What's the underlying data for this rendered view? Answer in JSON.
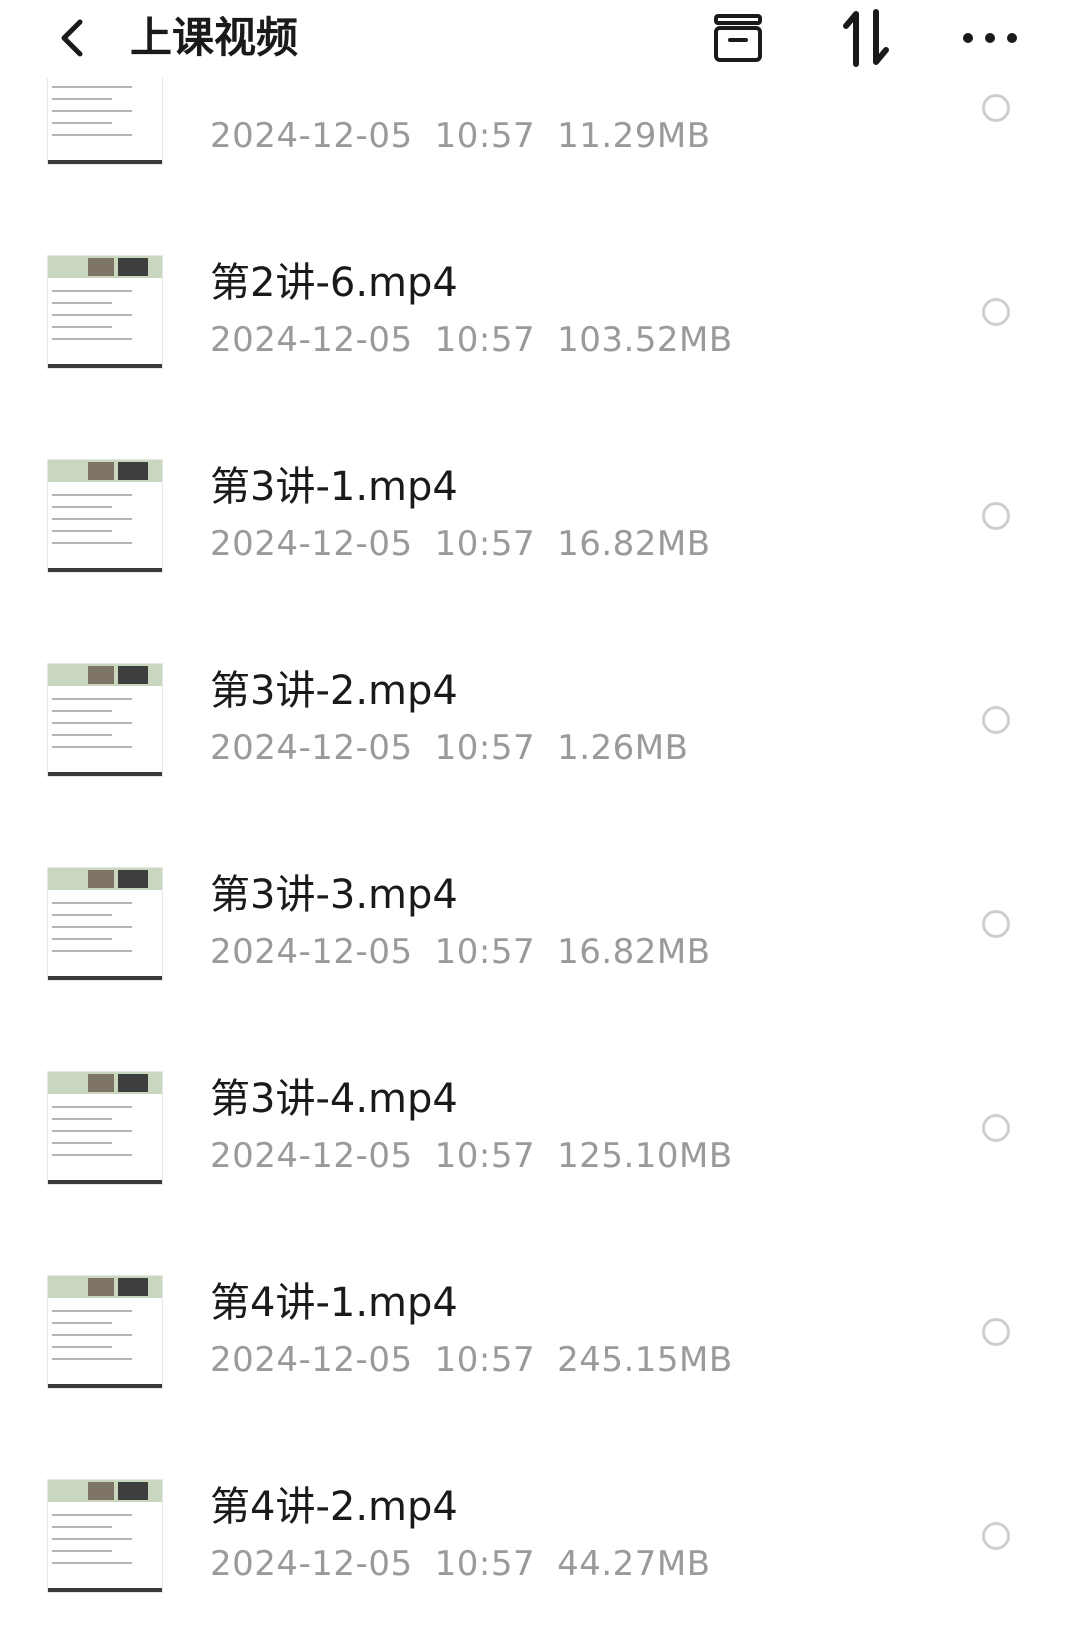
{
  "header": {
    "title": "上课视频",
    "back_icon": "chevron-left-icon",
    "actions": [
      {
        "name": "archive-icon"
      },
      {
        "name": "sort-icon"
      },
      {
        "name": "more-icon"
      }
    ]
  },
  "files": [
    {
      "name": "",
      "date": "2024-12-05",
      "time": "10:57",
      "size": "11.29MB"
    },
    {
      "name": "第2讲-6.mp4",
      "date": "2024-12-05",
      "time": "10:57",
      "size": "103.52MB"
    },
    {
      "name": "第3讲-1.mp4",
      "date": "2024-12-05",
      "time": "10:57",
      "size": "16.82MB"
    },
    {
      "name": "第3讲-2.mp4",
      "date": "2024-12-05",
      "time": "10:57",
      "size": "1.26MB"
    },
    {
      "name": "第3讲-3.mp4",
      "date": "2024-12-05",
      "time": "10:57",
      "size": "16.82MB"
    },
    {
      "name": "第3讲-4.mp4",
      "date": "2024-12-05",
      "time": "10:57",
      "size": "125.10MB"
    },
    {
      "name": "第4讲-1.mp4",
      "date": "2024-12-05",
      "time": "10:57",
      "size": "245.15MB"
    },
    {
      "name": "第4讲-2.mp4",
      "date": "2024-12-05",
      "time": "10:57",
      "size": "44.27MB"
    }
  ]
}
